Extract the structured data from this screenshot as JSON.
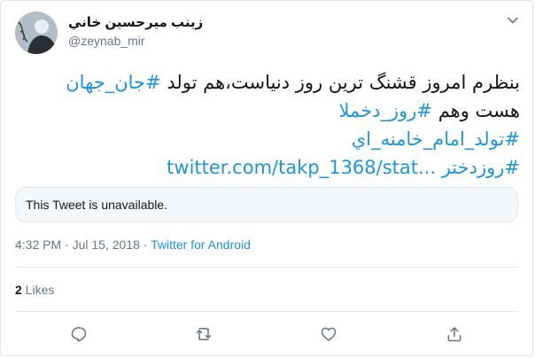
{
  "author": {
    "display_name": "زينب ميرحسين خاني",
    "handle": "@zeynab_mir"
  },
  "tweet": {
    "line1_text": "بنظرم امروز قشنگ ترين روز دنياست،هم تولد ",
    "line1_hashtag": "#جان_جهان",
    "line2_text": "هست وهم ",
    "line2_hashtag": "#روز_دخملا",
    "line3_hashtag": "#تولد_امام_خامنه_اي",
    "line4_hashtag": "#روزدختر",
    "line4_link": "twitter.com/takp_1368/stat..."
  },
  "quoted": {
    "unavailable_text": "This Tweet is unavailable."
  },
  "meta": {
    "time": "4:32 PM",
    "separator": "·",
    "date": "Jul 15, 2018",
    "source": "Twitter for Android"
  },
  "stats": {
    "likes_count": "2",
    "likes_label": " Likes"
  },
  "icons": {
    "caret": "chevron-down-icon",
    "reply": "reply-icon",
    "retweet": "retweet-icon",
    "like": "heart-icon",
    "share": "share-icon"
  },
  "colors": {
    "link": "#1b95e0",
    "secondary_text": "#657786",
    "border": "#e1e8ed"
  }
}
